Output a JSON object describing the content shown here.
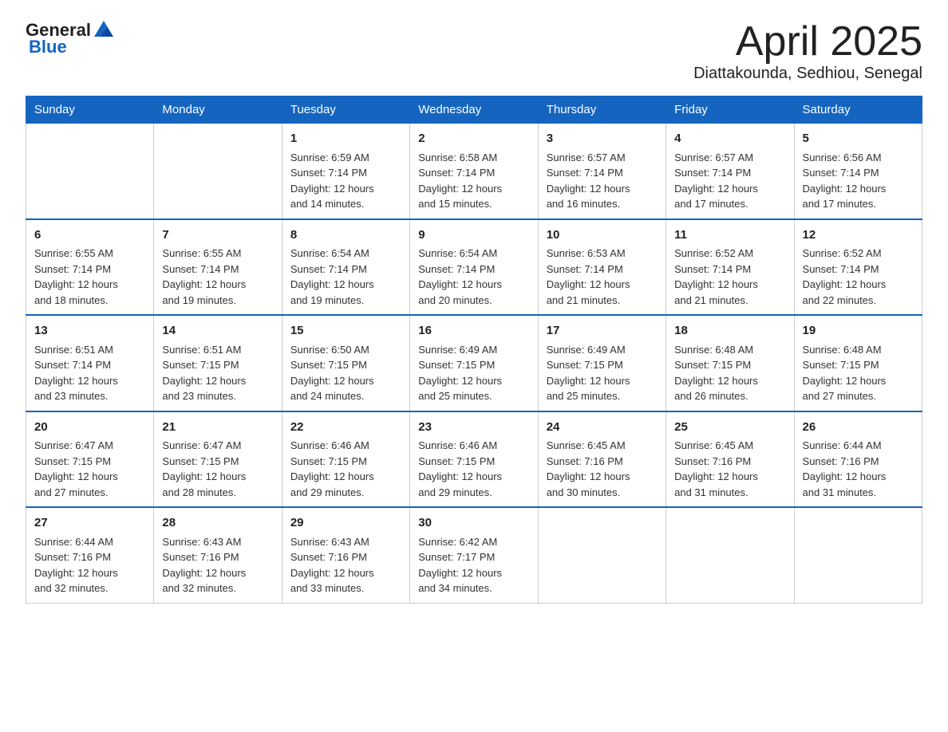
{
  "header": {
    "logo_general": "General",
    "logo_blue": "Blue",
    "title": "April 2025",
    "subtitle": "Diattakounda, Sedhiou, Senegal"
  },
  "weekdays": [
    "Sunday",
    "Monday",
    "Tuesday",
    "Wednesday",
    "Thursday",
    "Friday",
    "Saturday"
  ],
  "weeks": [
    [
      {
        "day": "",
        "info": ""
      },
      {
        "day": "",
        "info": ""
      },
      {
        "day": "1",
        "info": "Sunrise: 6:59 AM\nSunset: 7:14 PM\nDaylight: 12 hours\nand 14 minutes."
      },
      {
        "day": "2",
        "info": "Sunrise: 6:58 AM\nSunset: 7:14 PM\nDaylight: 12 hours\nand 15 minutes."
      },
      {
        "day": "3",
        "info": "Sunrise: 6:57 AM\nSunset: 7:14 PM\nDaylight: 12 hours\nand 16 minutes."
      },
      {
        "day": "4",
        "info": "Sunrise: 6:57 AM\nSunset: 7:14 PM\nDaylight: 12 hours\nand 17 minutes."
      },
      {
        "day": "5",
        "info": "Sunrise: 6:56 AM\nSunset: 7:14 PM\nDaylight: 12 hours\nand 17 minutes."
      }
    ],
    [
      {
        "day": "6",
        "info": "Sunrise: 6:55 AM\nSunset: 7:14 PM\nDaylight: 12 hours\nand 18 minutes."
      },
      {
        "day": "7",
        "info": "Sunrise: 6:55 AM\nSunset: 7:14 PM\nDaylight: 12 hours\nand 19 minutes."
      },
      {
        "day": "8",
        "info": "Sunrise: 6:54 AM\nSunset: 7:14 PM\nDaylight: 12 hours\nand 19 minutes."
      },
      {
        "day": "9",
        "info": "Sunrise: 6:54 AM\nSunset: 7:14 PM\nDaylight: 12 hours\nand 20 minutes."
      },
      {
        "day": "10",
        "info": "Sunrise: 6:53 AM\nSunset: 7:14 PM\nDaylight: 12 hours\nand 21 minutes."
      },
      {
        "day": "11",
        "info": "Sunrise: 6:52 AM\nSunset: 7:14 PM\nDaylight: 12 hours\nand 21 minutes."
      },
      {
        "day": "12",
        "info": "Sunrise: 6:52 AM\nSunset: 7:14 PM\nDaylight: 12 hours\nand 22 minutes."
      }
    ],
    [
      {
        "day": "13",
        "info": "Sunrise: 6:51 AM\nSunset: 7:14 PM\nDaylight: 12 hours\nand 23 minutes."
      },
      {
        "day": "14",
        "info": "Sunrise: 6:51 AM\nSunset: 7:15 PM\nDaylight: 12 hours\nand 23 minutes."
      },
      {
        "day": "15",
        "info": "Sunrise: 6:50 AM\nSunset: 7:15 PM\nDaylight: 12 hours\nand 24 minutes."
      },
      {
        "day": "16",
        "info": "Sunrise: 6:49 AM\nSunset: 7:15 PM\nDaylight: 12 hours\nand 25 minutes."
      },
      {
        "day": "17",
        "info": "Sunrise: 6:49 AM\nSunset: 7:15 PM\nDaylight: 12 hours\nand 25 minutes."
      },
      {
        "day": "18",
        "info": "Sunrise: 6:48 AM\nSunset: 7:15 PM\nDaylight: 12 hours\nand 26 minutes."
      },
      {
        "day": "19",
        "info": "Sunrise: 6:48 AM\nSunset: 7:15 PM\nDaylight: 12 hours\nand 27 minutes."
      }
    ],
    [
      {
        "day": "20",
        "info": "Sunrise: 6:47 AM\nSunset: 7:15 PM\nDaylight: 12 hours\nand 27 minutes."
      },
      {
        "day": "21",
        "info": "Sunrise: 6:47 AM\nSunset: 7:15 PM\nDaylight: 12 hours\nand 28 minutes."
      },
      {
        "day": "22",
        "info": "Sunrise: 6:46 AM\nSunset: 7:15 PM\nDaylight: 12 hours\nand 29 minutes."
      },
      {
        "day": "23",
        "info": "Sunrise: 6:46 AM\nSunset: 7:15 PM\nDaylight: 12 hours\nand 29 minutes."
      },
      {
        "day": "24",
        "info": "Sunrise: 6:45 AM\nSunset: 7:16 PM\nDaylight: 12 hours\nand 30 minutes."
      },
      {
        "day": "25",
        "info": "Sunrise: 6:45 AM\nSunset: 7:16 PM\nDaylight: 12 hours\nand 31 minutes."
      },
      {
        "day": "26",
        "info": "Sunrise: 6:44 AM\nSunset: 7:16 PM\nDaylight: 12 hours\nand 31 minutes."
      }
    ],
    [
      {
        "day": "27",
        "info": "Sunrise: 6:44 AM\nSunset: 7:16 PM\nDaylight: 12 hours\nand 32 minutes."
      },
      {
        "day": "28",
        "info": "Sunrise: 6:43 AM\nSunset: 7:16 PM\nDaylight: 12 hours\nand 32 minutes."
      },
      {
        "day": "29",
        "info": "Sunrise: 6:43 AM\nSunset: 7:16 PM\nDaylight: 12 hours\nand 33 minutes."
      },
      {
        "day": "30",
        "info": "Sunrise: 6:42 AM\nSunset: 7:17 PM\nDaylight: 12 hours\nand 34 minutes."
      },
      {
        "day": "",
        "info": ""
      },
      {
        "day": "",
        "info": ""
      },
      {
        "day": "",
        "info": ""
      }
    ]
  ]
}
